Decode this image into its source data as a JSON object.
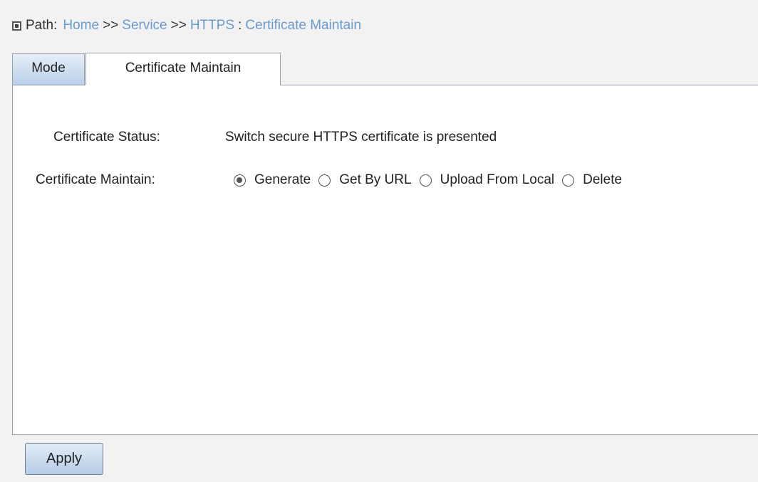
{
  "breadcrumb": {
    "label": "Path:",
    "items": [
      "Home",
      "Service",
      "HTTPS",
      "Certificate Maintain"
    ],
    "separator": ">>",
    "last_separator": ":"
  },
  "tabs": [
    {
      "label": "Mode",
      "active": false
    },
    {
      "label": "Certificate Maintain",
      "active": true
    }
  ],
  "form": {
    "status_label": "Certificate Status:",
    "status_value": "Switch secure HTTPS certificate is presented",
    "maintain_label": "Certificate Maintain:",
    "options": [
      {
        "label": "Generate",
        "checked": true
      },
      {
        "label": "Get By URL",
        "checked": false
      },
      {
        "label": "Upload From Local",
        "checked": false
      },
      {
        "label": "Delete",
        "checked": false
      }
    ]
  },
  "actions": {
    "apply_label": "Apply"
  },
  "colors": {
    "link": "#6a9bd0",
    "tab_active_bg": "#ffffff",
    "tab_inactive_bg": "#b8cfe9",
    "button_bg": "#b6cce6"
  }
}
